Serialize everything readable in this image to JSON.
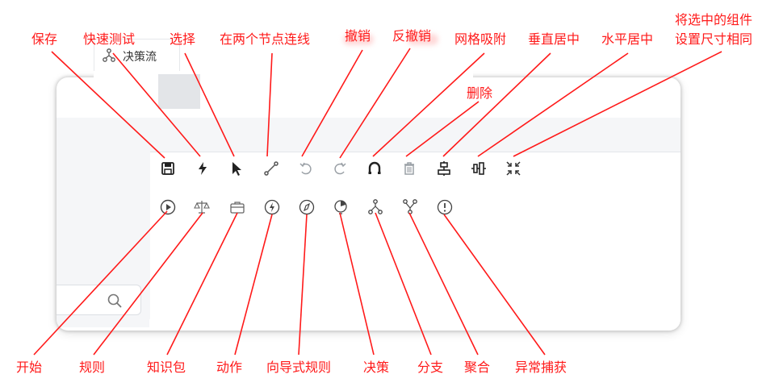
{
  "tab": {
    "label": "决策流"
  },
  "toolbar_labels": {
    "save": "保存",
    "quick_test": "快速测试",
    "select": "选择",
    "connect": "在两个节点连线",
    "undo": "撤销",
    "redo": "反撤销",
    "grid_snap": "网格吸附",
    "delete": "删除",
    "vcenter": "垂直居中",
    "hcenter": "水平居中",
    "same_size_1": "将选中的组件",
    "same_size_2": "设置尺寸相同"
  },
  "node_labels": {
    "start": "开始",
    "rule": "规则",
    "knowledge": "知识包",
    "action": "动作",
    "wizard_rule": "向导式规则",
    "decision": "决策",
    "branch": "分支",
    "join": "聚合",
    "exception": "异常捕获"
  },
  "colors": {
    "annotation": "#ff1a1a",
    "icon": "#555555",
    "icon_light": "#9aa0a6"
  }
}
